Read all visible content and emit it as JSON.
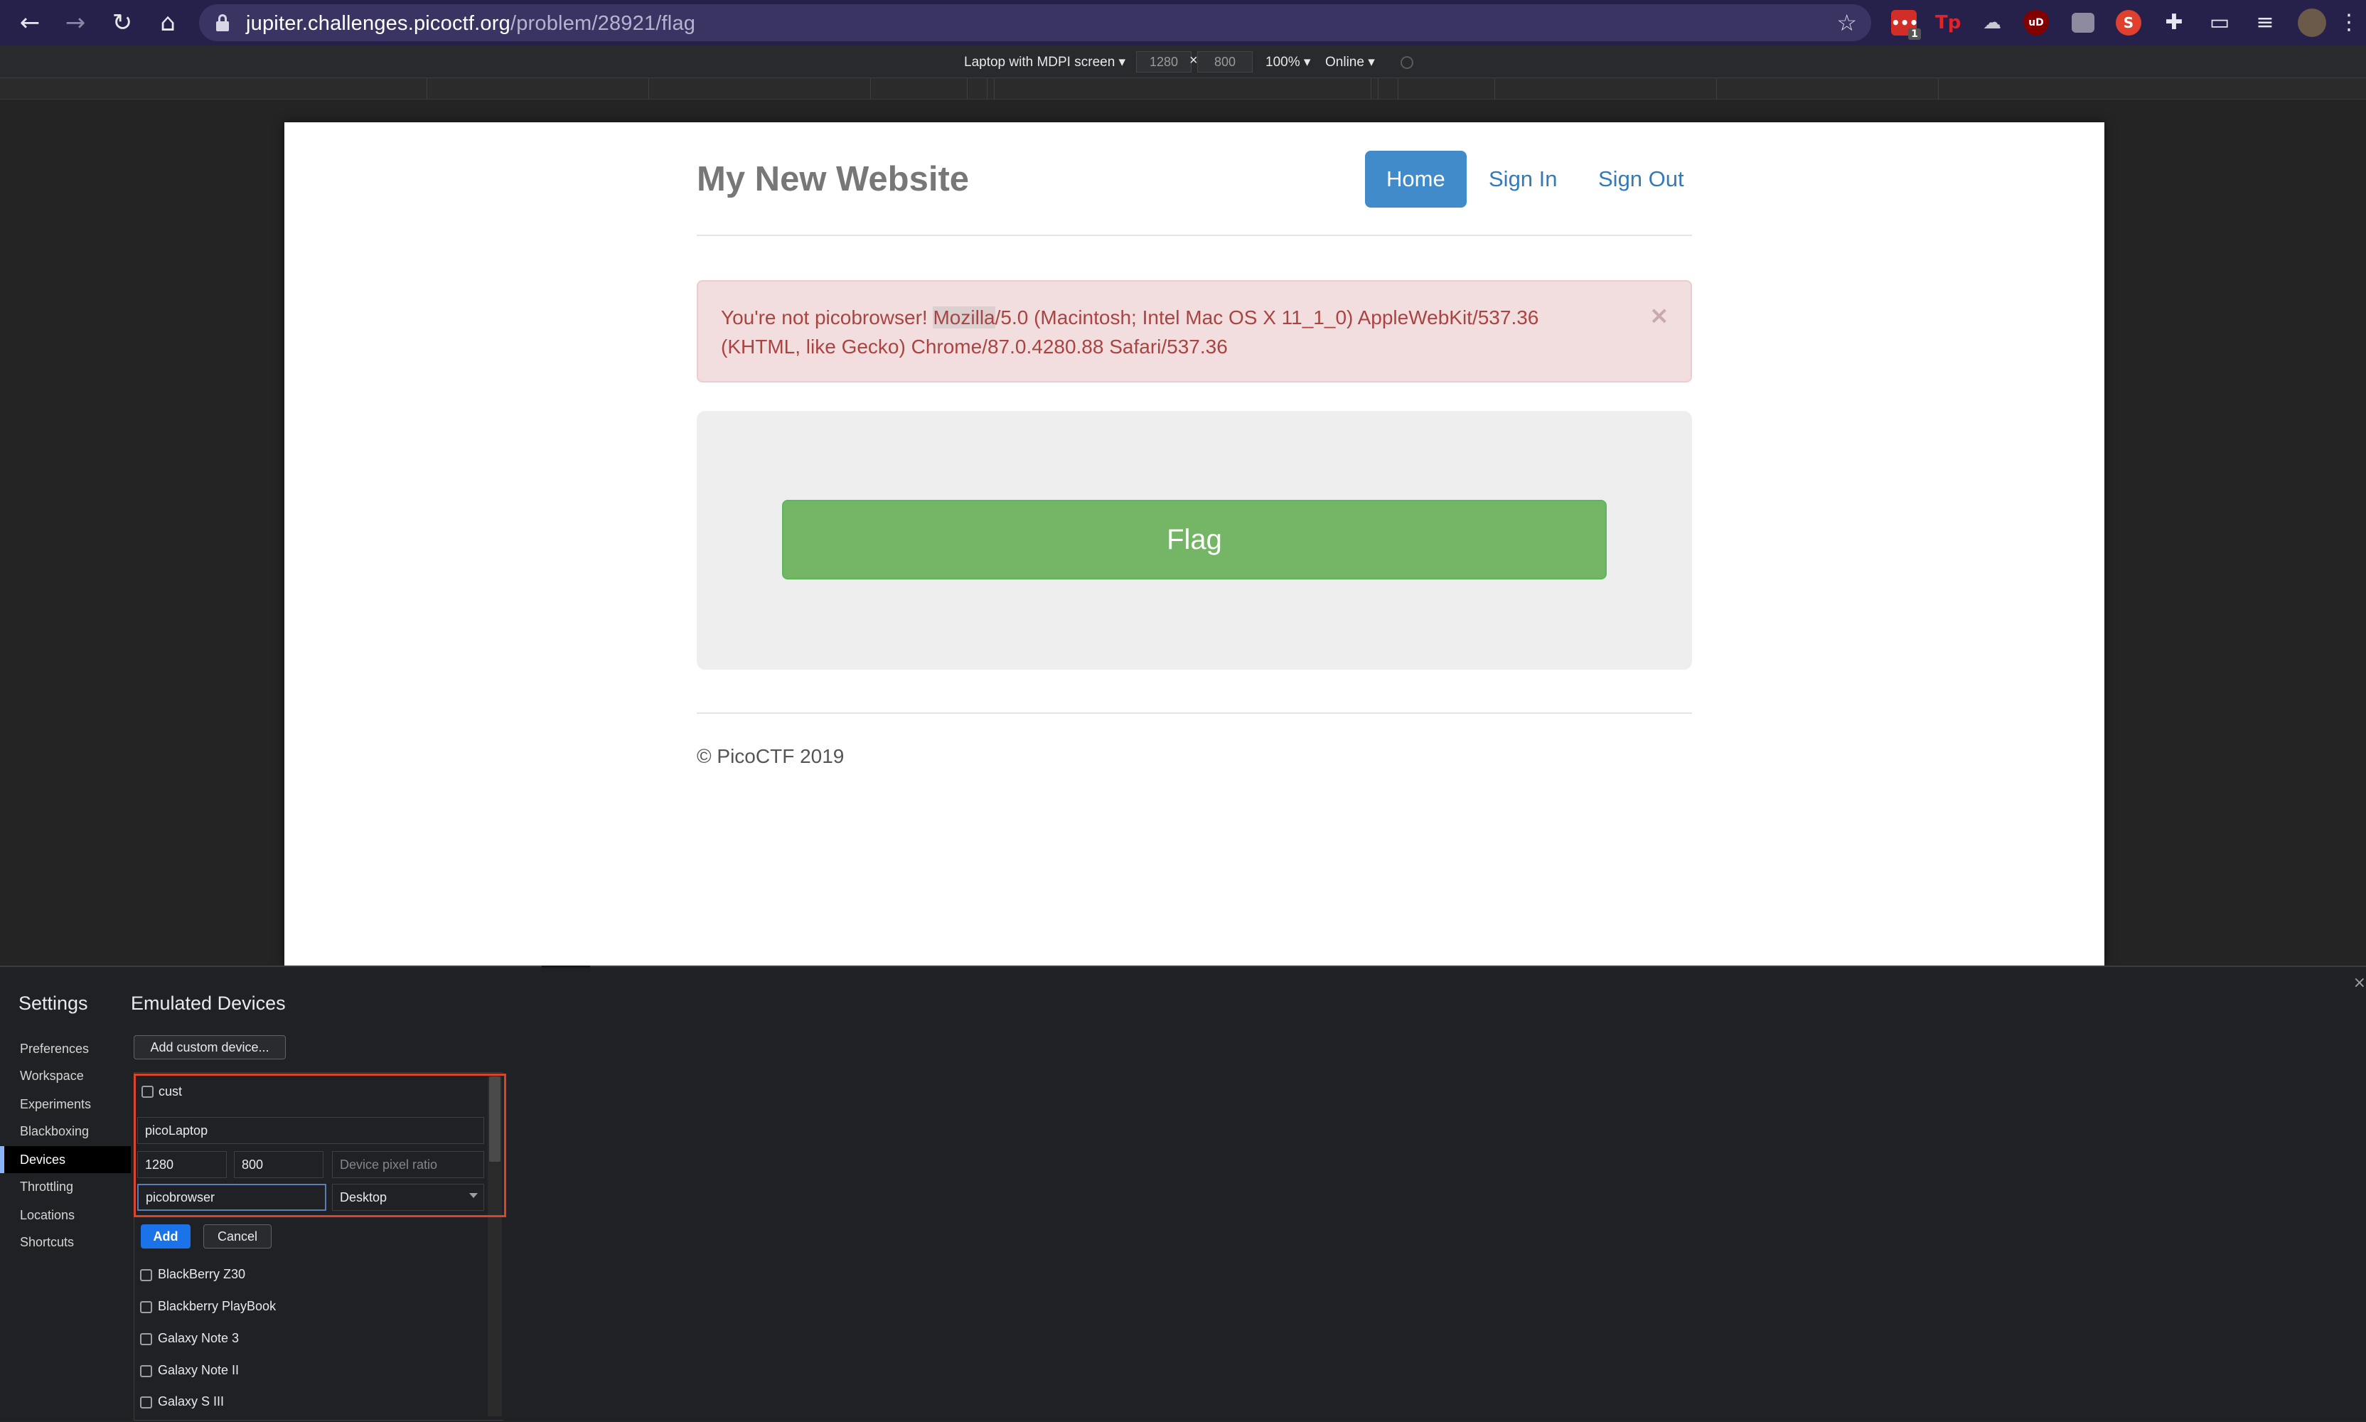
{
  "browser": {
    "url_host": "jupiter.challenges.picoctf.org",
    "url_path": "/problem/28921/flag",
    "extensions": [
      {
        "name": "lastpass-icon",
        "badge": "1",
        "color": "#d32d27"
      },
      {
        "name": "tp-extension-icon",
        "label": "Tp",
        "color": "#e0242b"
      },
      {
        "name": "cloud-extension-icon",
        "color": "#9aa0a6"
      },
      {
        "name": "ublock-icon",
        "label": "uD",
        "color": "#800000"
      },
      {
        "name": "briefcase-extension-icon",
        "color": "#9aa0a6"
      },
      {
        "name": "s-extension-icon",
        "label": "S",
        "color": "#e0402e"
      }
    ]
  },
  "devtools_toolbar": {
    "device": "Laptop with MDPI screen",
    "width": "1280",
    "times": "×",
    "height": "800",
    "zoom": "100%",
    "network": "Online"
  },
  "site": {
    "brand": "My New Website",
    "nav": [
      "Home",
      "Sign In",
      "Sign Out"
    ],
    "alert_prefix": "You're not picobrowser! ",
    "alert_highlight": "Mozilla",
    "alert_rest": "/5.0 (Macintosh; Intel Mac OS X 11_1_0) AppleWebKit/537.36 (KHTML, like Gecko) Chrome/87.0.4280.88 Safari/537.36",
    "alert_close": "×",
    "flag_button": "Flag",
    "footer": "© PicoCTF 2019"
  },
  "settings": {
    "title": "Settings",
    "sidebar": [
      "Preferences",
      "Workspace",
      "Experiments",
      "Blackboxing",
      "Devices",
      "Throttling",
      "Locations",
      "Shortcuts"
    ],
    "selected": "Devices",
    "content_title": "Emulated Devices",
    "add_custom_device": "Add custom device...",
    "editor": {
      "existing_device": "cust",
      "device_name": "picoLaptop",
      "width": "1280",
      "height": "800",
      "dpr_placeholder": "Device pixel ratio",
      "user_agent": "picobrowser",
      "device_type": "Desktop",
      "add": "Add",
      "cancel": "Cancel"
    },
    "devices": [
      "BlackBerry Z30",
      "Blackberry PlayBook",
      "Galaxy Note 3",
      "Galaxy Note II",
      "Galaxy S III"
    ]
  }
}
